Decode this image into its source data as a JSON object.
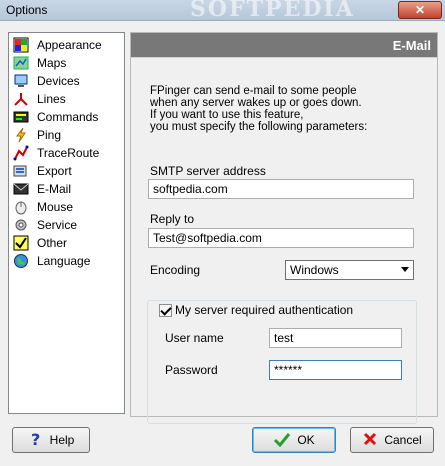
{
  "window": {
    "title": "Options",
    "watermark": "SOFTPEDIA",
    "close_glyph": "✕"
  },
  "sidebar": {
    "items": [
      {
        "label": "Appearance",
        "icon": "appearance-icon"
      },
      {
        "label": "Maps",
        "icon": "maps-icon"
      },
      {
        "label": "Devices",
        "icon": "devices-icon"
      },
      {
        "label": "Lines",
        "icon": "lines-icon"
      },
      {
        "label": "Commands",
        "icon": "commands-icon"
      },
      {
        "label": "Ping",
        "icon": "ping-icon"
      },
      {
        "label": "TraceRoute",
        "icon": "traceroute-icon"
      },
      {
        "label": "Export",
        "icon": "export-icon"
      },
      {
        "label": "E-Mail",
        "icon": "email-icon"
      },
      {
        "label": "Mouse",
        "icon": "mouse-icon"
      },
      {
        "label": "Service",
        "icon": "service-icon"
      },
      {
        "label": "Other",
        "icon": "other-icon"
      },
      {
        "label": "Language",
        "icon": "language-icon"
      }
    ]
  },
  "panel": {
    "title": "E-Mail",
    "description": [
      "FPinger can send e-mail to some people",
      "when any server wakes up or goes down.",
      "If you want to use this feature,",
      "you must specify the following parameters:"
    ],
    "smtp_label": "SMTP server address",
    "smtp_value": "softpedia.com",
    "reply_label": "Reply to",
    "reply_value": "Test@softpedia.com",
    "encoding_label": "Encoding",
    "encoding_value": "Windows",
    "auth_label": "My server required authentication",
    "username_label": "User name",
    "username_value": "test",
    "password_label": "Password",
    "password_value": "******"
  },
  "buttons": {
    "help": "Help",
    "ok": "OK",
    "cancel": "Cancel"
  },
  "colors": {
    "panel_header": "#787878",
    "close_button": "#c4412c"
  }
}
